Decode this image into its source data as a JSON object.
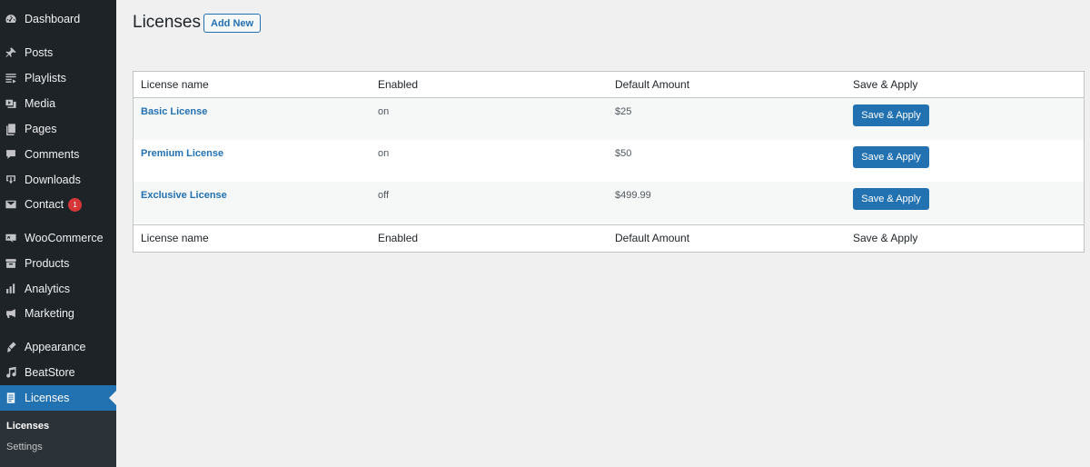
{
  "sidebar": {
    "items": [
      {
        "label": "Dashboard",
        "icon": "dashboard-icon"
      },
      {
        "label": "Posts",
        "icon": "pin-icon"
      },
      {
        "label": "Playlists",
        "icon": "playlist-icon"
      },
      {
        "label": "Media",
        "icon": "media-icon"
      },
      {
        "label": "Pages",
        "icon": "pages-icon"
      },
      {
        "label": "Comments",
        "icon": "comment-icon"
      },
      {
        "label": "Downloads",
        "icon": "download-icon"
      },
      {
        "label": "Contact",
        "icon": "mail-icon",
        "badge": "1"
      },
      {
        "label": "WooCommerce",
        "icon": "woocommerce-icon"
      },
      {
        "label": "Products",
        "icon": "archive-icon"
      },
      {
        "label": "Analytics",
        "icon": "chart-bar-icon"
      },
      {
        "label": "Marketing",
        "icon": "megaphone-icon"
      },
      {
        "label": "Appearance",
        "icon": "brush-icon"
      },
      {
        "label": "BeatStore",
        "icon": "music-note-icon"
      },
      {
        "label": "Licenses",
        "icon": "document-icon"
      }
    ],
    "submenu": [
      {
        "label": "Licenses"
      },
      {
        "label": "Settings"
      }
    ]
  },
  "header": {
    "title": "Licenses",
    "add_new": "Add New"
  },
  "table": {
    "columns": [
      "License name",
      "Enabled",
      "Default Amount",
      "Save & Apply"
    ],
    "rows": [
      {
        "name": "Basic License",
        "enabled": "on",
        "amount": "$25",
        "action": "Save & Apply"
      },
      {
        "name": "Premium License",
        "enabled": "on",
        "amount": "$50",
        "action": "Save & Apply"
      },
      {
        "name": "Exclusive License",
        "enabled": "off",
        "amount": "$499.99",
        "action": "Save & Apply"
      }
    ]
  },
  "colors": {
    "sidebar_bg": "#1d2327",
    "accent": "#2271b1",
    "badge": "#d63638",
    "page_bg": "#f0f0f1"
  }
}
